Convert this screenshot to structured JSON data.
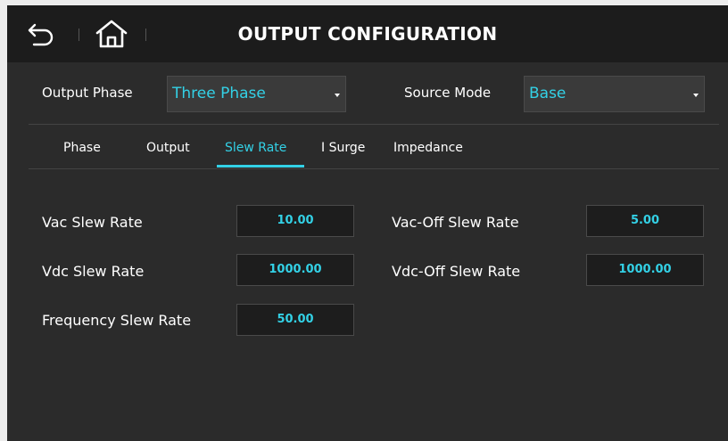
{
  "header": {
    "title": "OUTPUT CONFIGURATION",
    "back_icon": "back-arrow-icon",
    "home_icon": "home-icon"
  },
  "config": {
    "output_phase_label": "Output Phase",
    "output_phase_value": "Three Phase",
    "source_mode_label": "Source Mode",
    "source_mode_value": "Base"
  },
  "tabs": [
    {
      "label": "Phase",
      "active": false
    },
    {
      "label": "Output",
      "active": false
    },
    {
      "label": "Slew Rate",
      "active": true
    },
    {
      "label": "I Surge",
      "active": false
    },
    {
      "label": "Impedance",
      "active": false
    }
  ],
  "fields": {
    "vac": {
      "label": "Vac Slew Rate",
      "value": "10.00"
    },
    "vdc": {
      "label": "Vdc Slew Rate",
      "value": "1000.00"
    },
    "freq": {
      "label": "Frequency Slew Rate",
      "value": "50.00"
    },
    "vac_off": {
      "label": "Vac-Off Slew Rate",
      "value": "5.00"
    },
    "vdc_off": {
      "label": "Vdc-Off Slew Rate",
      "value": "1000.00"
    }
  },
  "colors": {
    "accent": "#33d1e6",
    "background": "#2b2b2b",
    "header_bg": "#1c1c1c"
  }
}
